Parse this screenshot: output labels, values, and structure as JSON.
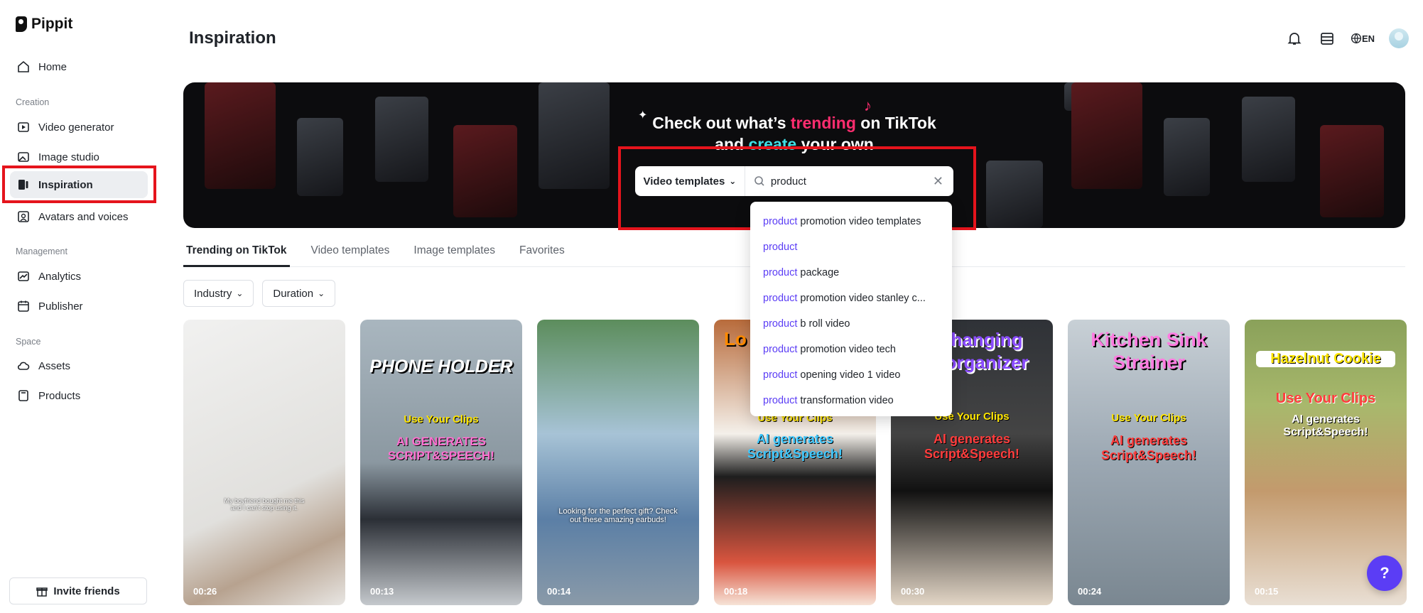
{
  "brand": {
    "name": "Pippit"
  },
  "sidebar": {
    "items": [
      {
        "label": "Home",
        "icon": "home-icon"
      },
      {
        "label": "Video generator",
        "icon": "video-plus-icon"
      },
      {
        "label": "Image studio",
        "icon": "image-icon"
      },
      {
        "label": "Inspiration",
        "icon": "inspiration-icon",
        "active": true
      },
      {
        "label": "Avatars and voices",
        "icon": "avatar-icon"
      },
      {
        "label": "Analytics",
        "icon": "analytics-icon"
      },
      {
        "label": "Publisher",
        "icon": "calendar-icon"
      },
      {
        "label": "Assets",
        "icon": "cloud-icon"
      },
      {
        "label": "Products",
        "icon": "box-icon"
      }
    ],
    "sections": [
      "Creation",
      "Management",
      "Space"
    ],
    "invite_label": "Invite friends"
  },
  "header": {
    "title": "Inspiration",
    "lang": "EN"
  },
  "banner": {
    "line1_a": "Check out what’s ",
    "line1_b": "trending",
    "line1_c": " on TikTok",
    "line2_a": "and ",
    "line2_b": "create",
    "line2_c": " your own"
  },
  "search": {
    "type_label": "Video templates",
    "value": "product",
    "suggestions": [
      {
        "kw": "product",
        "rest": "promotion video templates"
      },
      {
        "kw": "product",
        "rest": ""
      },
      {
        "kw": "product",
        "rest": "package"
      },
      {
        "kw": "product",
        "rest": "promotion video stanley c..."
      },
      {
        "kw": "product",
        "rest": "b roll video"
      },
      {
        "kw": "product",
        "rest": "promotion video tech"
      },
      {
        "kw": "product",
        "rest": "opening video 1 video"
      },
      {
        "kw": "product",
        "rest": "transformation video"
      }
    ]
  },
  "tabs": [
    "Trending on TikTok",
    "Video templates",
    "Image templates",
    "Favorites"
  ],
  "filters": [
    "Industry",
    "Duration"
  ],
  "cards": [
    {
      "duration": "00:26",
      "caption": "My boyfriend bought me this and I can't stop using it."
    },
    {
      "duration": "00:13",
      "headline": "PHONE HOLDER",
      "sub1": "Use Your Clips",
      "sub2": "AI GENERATES SCRIPT&SPEECH!"
    },
    {
      "duration": "00:14",
      "caption": "Looking for the perfect gift? Check out these amazing earbuds!"
    },
    {
      "duration": "00:18",
      "headline": "Lo",
      "sub1": "Use Your Clips",
      "sub2": "AI generates Script&Speech!"
    },
    {
      "duration": "00:30",
      "headline": "hanging organizer",
      "sub1": "Use Your Clips",
      "sub2": "AI generates Script&Speech!"
    },
    {
      "duration": "00:24",
      "headline": "Kitchen Sink Strainer",
      "sub1": "Use Your Clips",
      "sub2": "AI generates Script&Speech!"
    },
    {
      "duration": "00:15",
      "headline": "Hazelnut Cookie",
      "sub1": "Use Your Clips",
      "sub2": "AI generates Script&Speech!"
    }
  ],
  "help_label": "?"
}
